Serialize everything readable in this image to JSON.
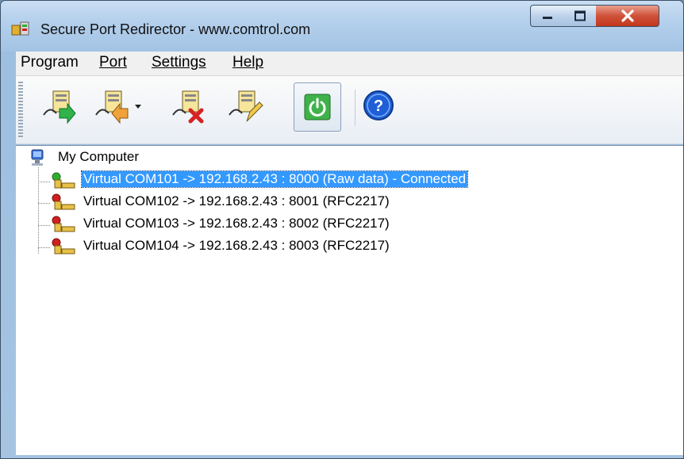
{
  "window": {
    "title": "Secure Port Redirector - www.comtrol.com",
    "caption_buttons": [
      "minimize-icon",
      "maximize-icon",
      "close-icon"
    ]
  },
  "menu": {
    "program": "Program",
    "port": "Port",
    "settings": "Settings",
    "help": "Help"
  },
  "toolbar": {
    "buttons": [
      {
        "name": "add-port-icon"
      },
      {
        "name": "remove-port-icon"
      },
      {
        "name": "dropdown-arrow-icon"
      },
      {
        "name": "delete-port-icon"
      },
      {
        "name": "edit-port-icon"
      },
      {
        "name": "power-icon"
      },
      {
        "name": "help-icon"
      }
    ]
  },
  "tree": {
    "root": "My Computer",
    "items": [
      {
        "label": "Virtual COM101 -> 192.168.2.43 : 8000 (Raw data) - Connected",
        "status": "connected",
        "status_color": "#2fae2f",
        "selected": true
      },
      {
        "label": "Virtual COM102 -> 192.168.2.43 : 8001 (RFC2217)",
        "status": "disconnected",
        "status_color": "#d02020"
      },
      {
        "label": "Virtual COM103 -> 192.168.2.43 : 8002 (RFC2217)",
        "status": "disconnected",
        "status_color": "#d02020"
      },
      {
        "label": "Virtual COM104 -> 192.168.2.43 : 8003 (RFC2217)",
        "status": "disconnected",
        "status_color": "#d02020"
      }
    ]
  },
  "colors": {
    "selection": "#3399ff",
    "close_button": "#c2361d",
    "power_green": "#3fb24a",
    "help_blue": "#1f5fd6"
  }
}
